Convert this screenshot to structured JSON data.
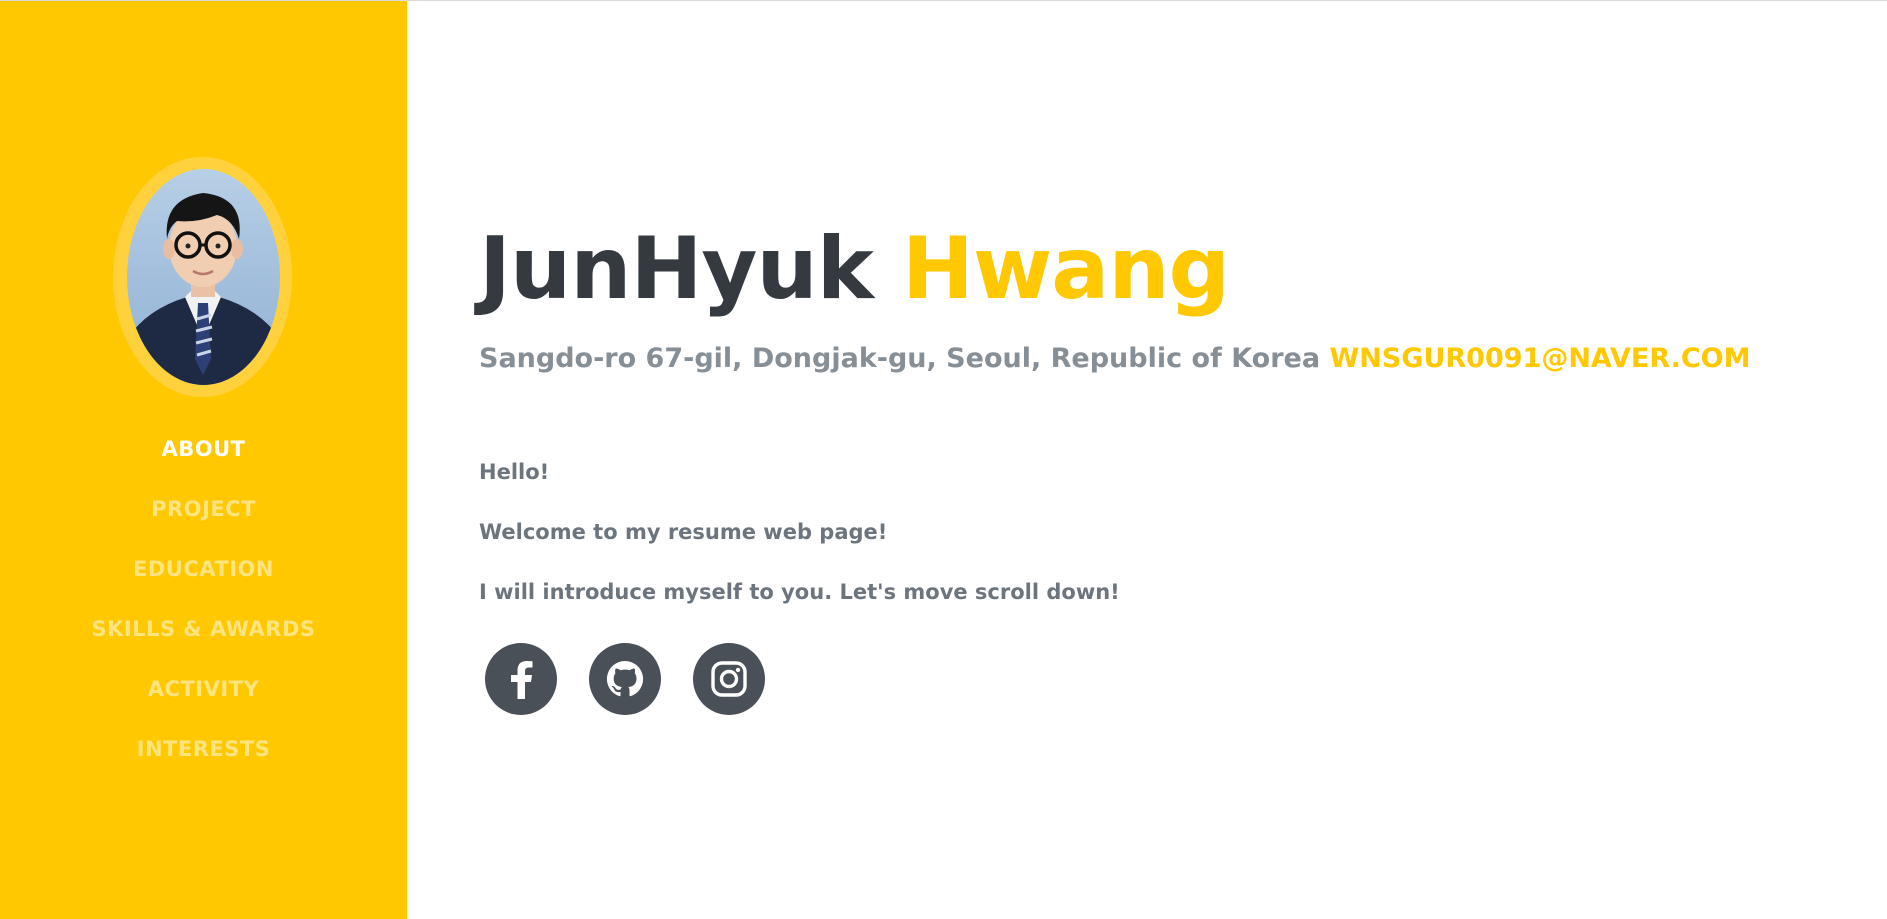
{
  "sidebar": {
    "brand_color": "#ffc800",
    "nav": [
      {
        "label": "ABOUT",
        "active": true
      },
      {
        "label": "PROJECT",
        "active": false
      },
      {
        "label": "EDUCATION",
        "active": false
      },
      {
        "label": "SKILLS & AWARDS",
        "active": false
      },
      {
        "label": "ACTIVITY",
        "active": false
      },
      {
        "label": "INTERESTS",
        "active": false
      }
    ]
  },
  "about": {
    "first_name": "JunHyuk",
    "last_name": "Hwang",
    "address": "Sangdo-ro 67-gil, Dongjak-gu, Seoul, Republic of Korea",
    "email": "WNSGUR0091@NAVER.COM",
    "intro": [
      "Hello!",
      "Welcome to my resume web page!",
      "I will introduce myself to you. Let's move scroll down!"
    ],
    "social": [
      {
        "icon": "facebook-icon"
      },
      {
        "icon": "github-icon"
      },
      {
        "icon": "instagram-icon"
      }
    ]
  },
  "colors": {
    "accent": "#ffc800",
    "heading": "#343a40",
    "muted": "#868e96",
    "social_bg": "#495057"
  }
}
